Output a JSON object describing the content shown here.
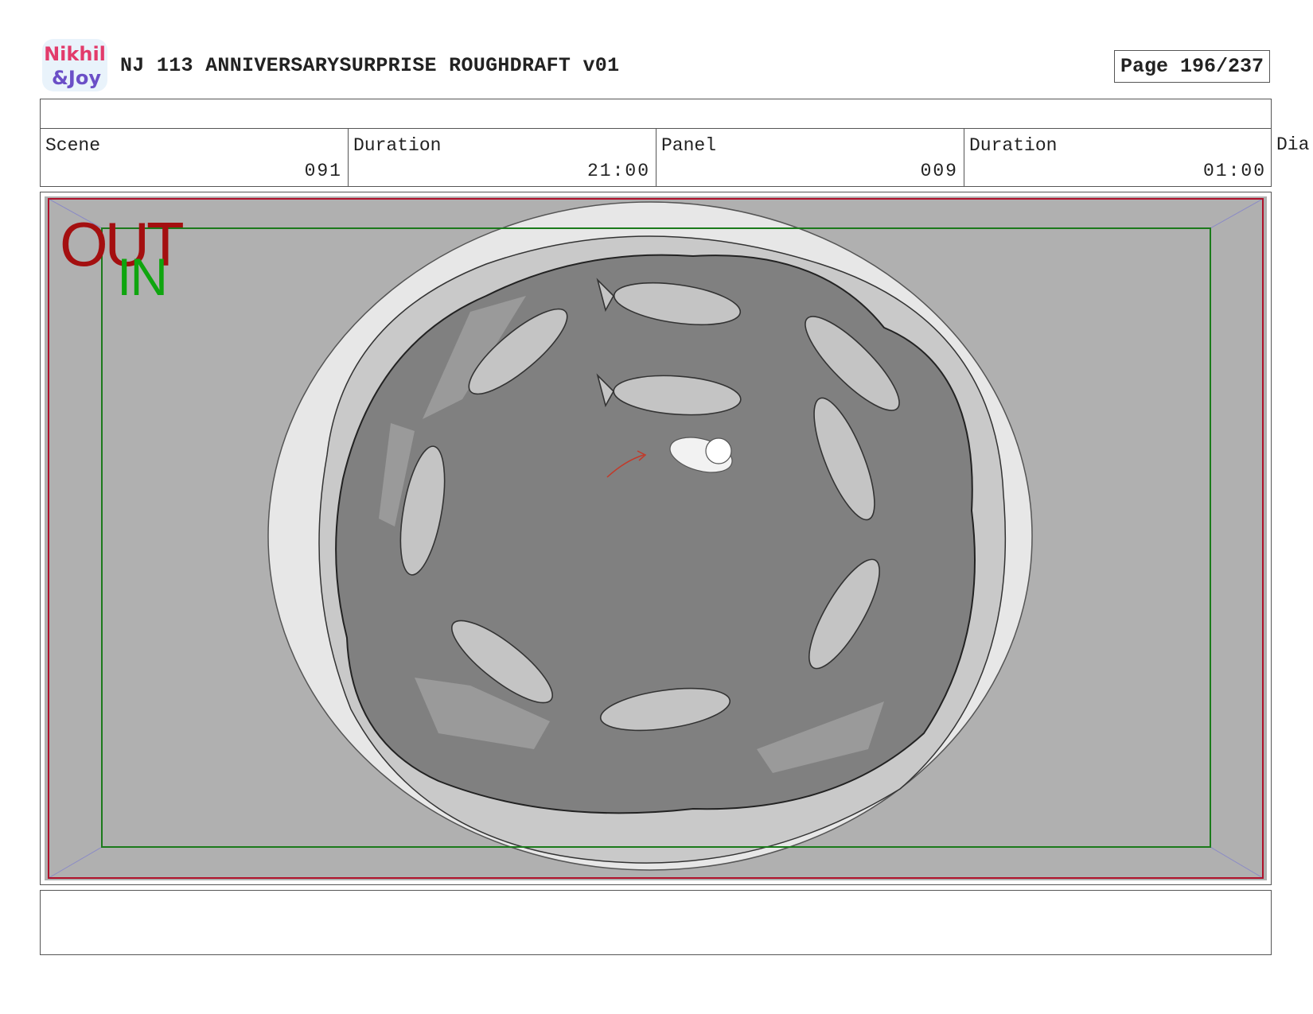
{
  "header": {
    "logo_text_top": "Nikhil",
    "logo_text_bottom": "&Joy",
    "title": "NJ 113 ANNIVERSARYSURPRISE ROUGHDRAFT v01",
    "page_label": "Page 196/237"
  },
  "info": {
    "scene_label": "Scene",
    "scene_value": "091",
    "scene_duration_label": "Duration",
    "scene_duration_value": "21:00",
    "panel_label": "Panel",
    "panel_value": "009",
    "panel_duration_label": "Duration",
    "panel_duration_value": "01:00",
    "dialogue_label_cut": "Dia"
  },
  "frame_labels": {
    "out": "OUT",
    "in": "IN"
  },
  "colors": {
    "out_frame": "#b0102a",
    "in_frame": "#1b7a1b",
    "water": "#7f7f7f",
    "background": "#b0b0b0"
  }
}
